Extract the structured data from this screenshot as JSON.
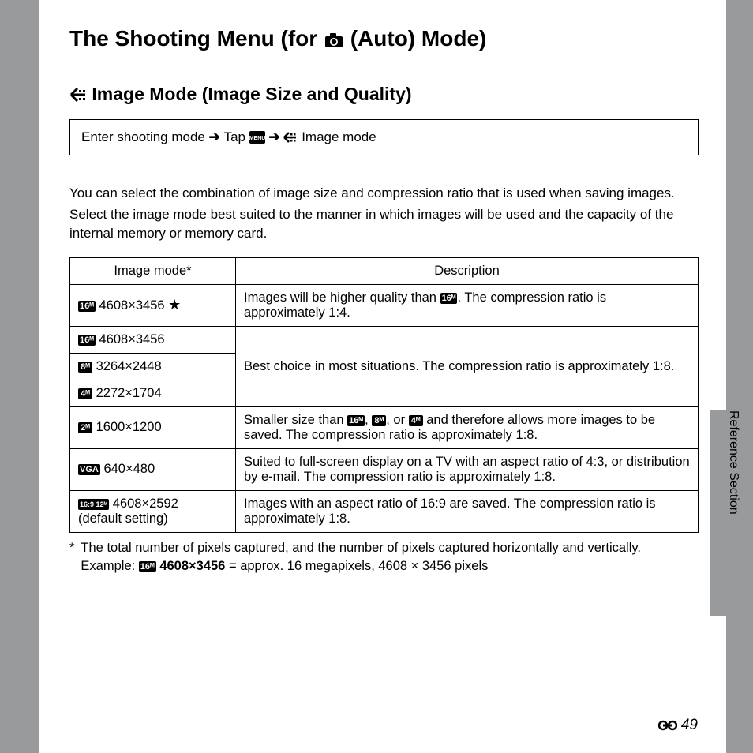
{
  "header": {
    "title_pre": "The Shooting Menu (for ",
    "title_post": " (Auto) Mode)"
  },
  "subsection": {
    "title": "Image Mode (Image Size and Quality)"
  },
  "breadcrumb": {
    "step1": "Enter shooting mode",
    "step2": "Tap",
    "step3": "Image mode"
  },
  "intro": {
    "p1": "You can select the combination of image size and compression ratio that is used when saving images.",
    "p2": "Select the image mode best suited to the manner in which images will be used and the capacity of the internal memory or memory card."
  },
  "table": {
    "col1": "Image mode*",
    "col2": "Description",
    "rows": [
      {
        "badge": "16ᴹ",
        "size": "4608×3456",
        "star": "★",
        "desc_pre": "Images will be higher quality than ",
        "desc_badge": "16ᴹ",
        "desc_post": ". The compression ratio is approximately 1:4."
      },
      {
        "badge": "16ᴹ",
        "size": "4608×3456",
        "group_desc": "Best choice in most situations. The compression ratio is approximately 1:8."
      },
      {
        "badge": "8ᴹ",
        "size": "3264×2448"
      },
      {
        "badge": "4ᴹ",
        "size": "2272×1704"
      },
      {
        "badge": "2ᴹ",
        "size": "1600×1200",
        "desc_pre": "Smaller size than ",
        "b1": "16ᴹ",
        "b2": "8ᴹ",
        "b3": "4ᴹ",
        "desc_post": " and therefore allows more images to be saved. The compression ratio is approximately 1:8."
      },
      {
        "badge": "VGA",
        "size": "640×480",
        "desc": "Suited to full-screen display on a TV with an aspect ratio of 4:3, or distribution by e-mail. The compression ratio is approximately 1:8."
      },
      {
        "badge": "16:9 12ᴹ",
        "size": "4608×2592",
        "extra": "(default setting)",
        "desc": "Images with an aspect ratio of 16:9 are saved. The compression ratio is approximately 1:8."
      }
    ]
  },
  "footnote": {
    "mark": "*",
    "line1": "The total number of pixels captured, and the number of pixels captured horizontally and vertically.",
    "ex_label": "Example: ",
    "ex_badge": "16ᴹ",
    "ex_bold": "4608×3456",
    "ex_rest": " = approx. 16 megapixels, 4608 × 3456 pixels"
  },
  "side": {
    "label": "Reference Section"
  },
  "page_number": "49"
}
